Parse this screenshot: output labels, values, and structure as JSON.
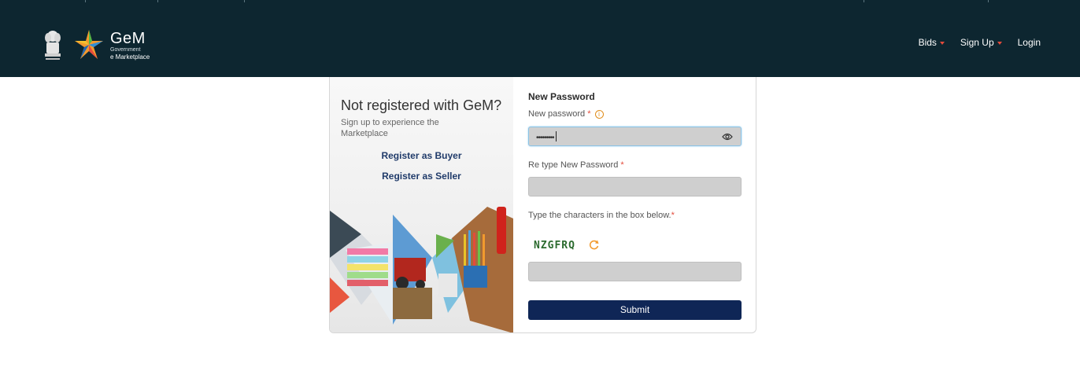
{
  "header": {
    "brand_title": "GeM",
    "brand_sub1": "Government",
    "brand_sub2": "e Marketplace",
    "nav": [
      {
        "label": "Bids",
        "dropdown": true
      },
      {
        "label": "Sign Up",
        "dropdown": true
      },
      {
        "label": "Login",
        "dropdown": false
      }
    ]
  },
  "left_panel": {
    "title": "Not registered with GeM?",
    "subtitle": "Sign up to experience the Marketplace",
    "register_buyer": "Register as Buyer",
    "register_seller": "Register as Seller"
  },
  "form": {
    "section_title": "New Password",
    "new_password_label": "New password",
    "new_password_value": "•••••••••",
    "retype_label": "Re type New Password",
    "retype_value": "",
    "captcha_label": "Type the characters in the box below.",
    "captcha_text": "NZGFRQ",
    "captcha_input_value": "",
    "required_mark": "*",
    "submit_label": "Submit"
  },
  "colors": {
    "header_bg": "#0d2630",
    "submit_bg": "#0f2656",
    "link": "#203b6a",
    "required": "#e34b3b",
    "captcha": "#2c6b2f"
  },
  "icons": [
    "emblem-icon",
    "gem-logo-icon",
    "info-icon",
    "eye-icon",
    "refresh-icon",
    "chevron-down-icon"
  ]
}
